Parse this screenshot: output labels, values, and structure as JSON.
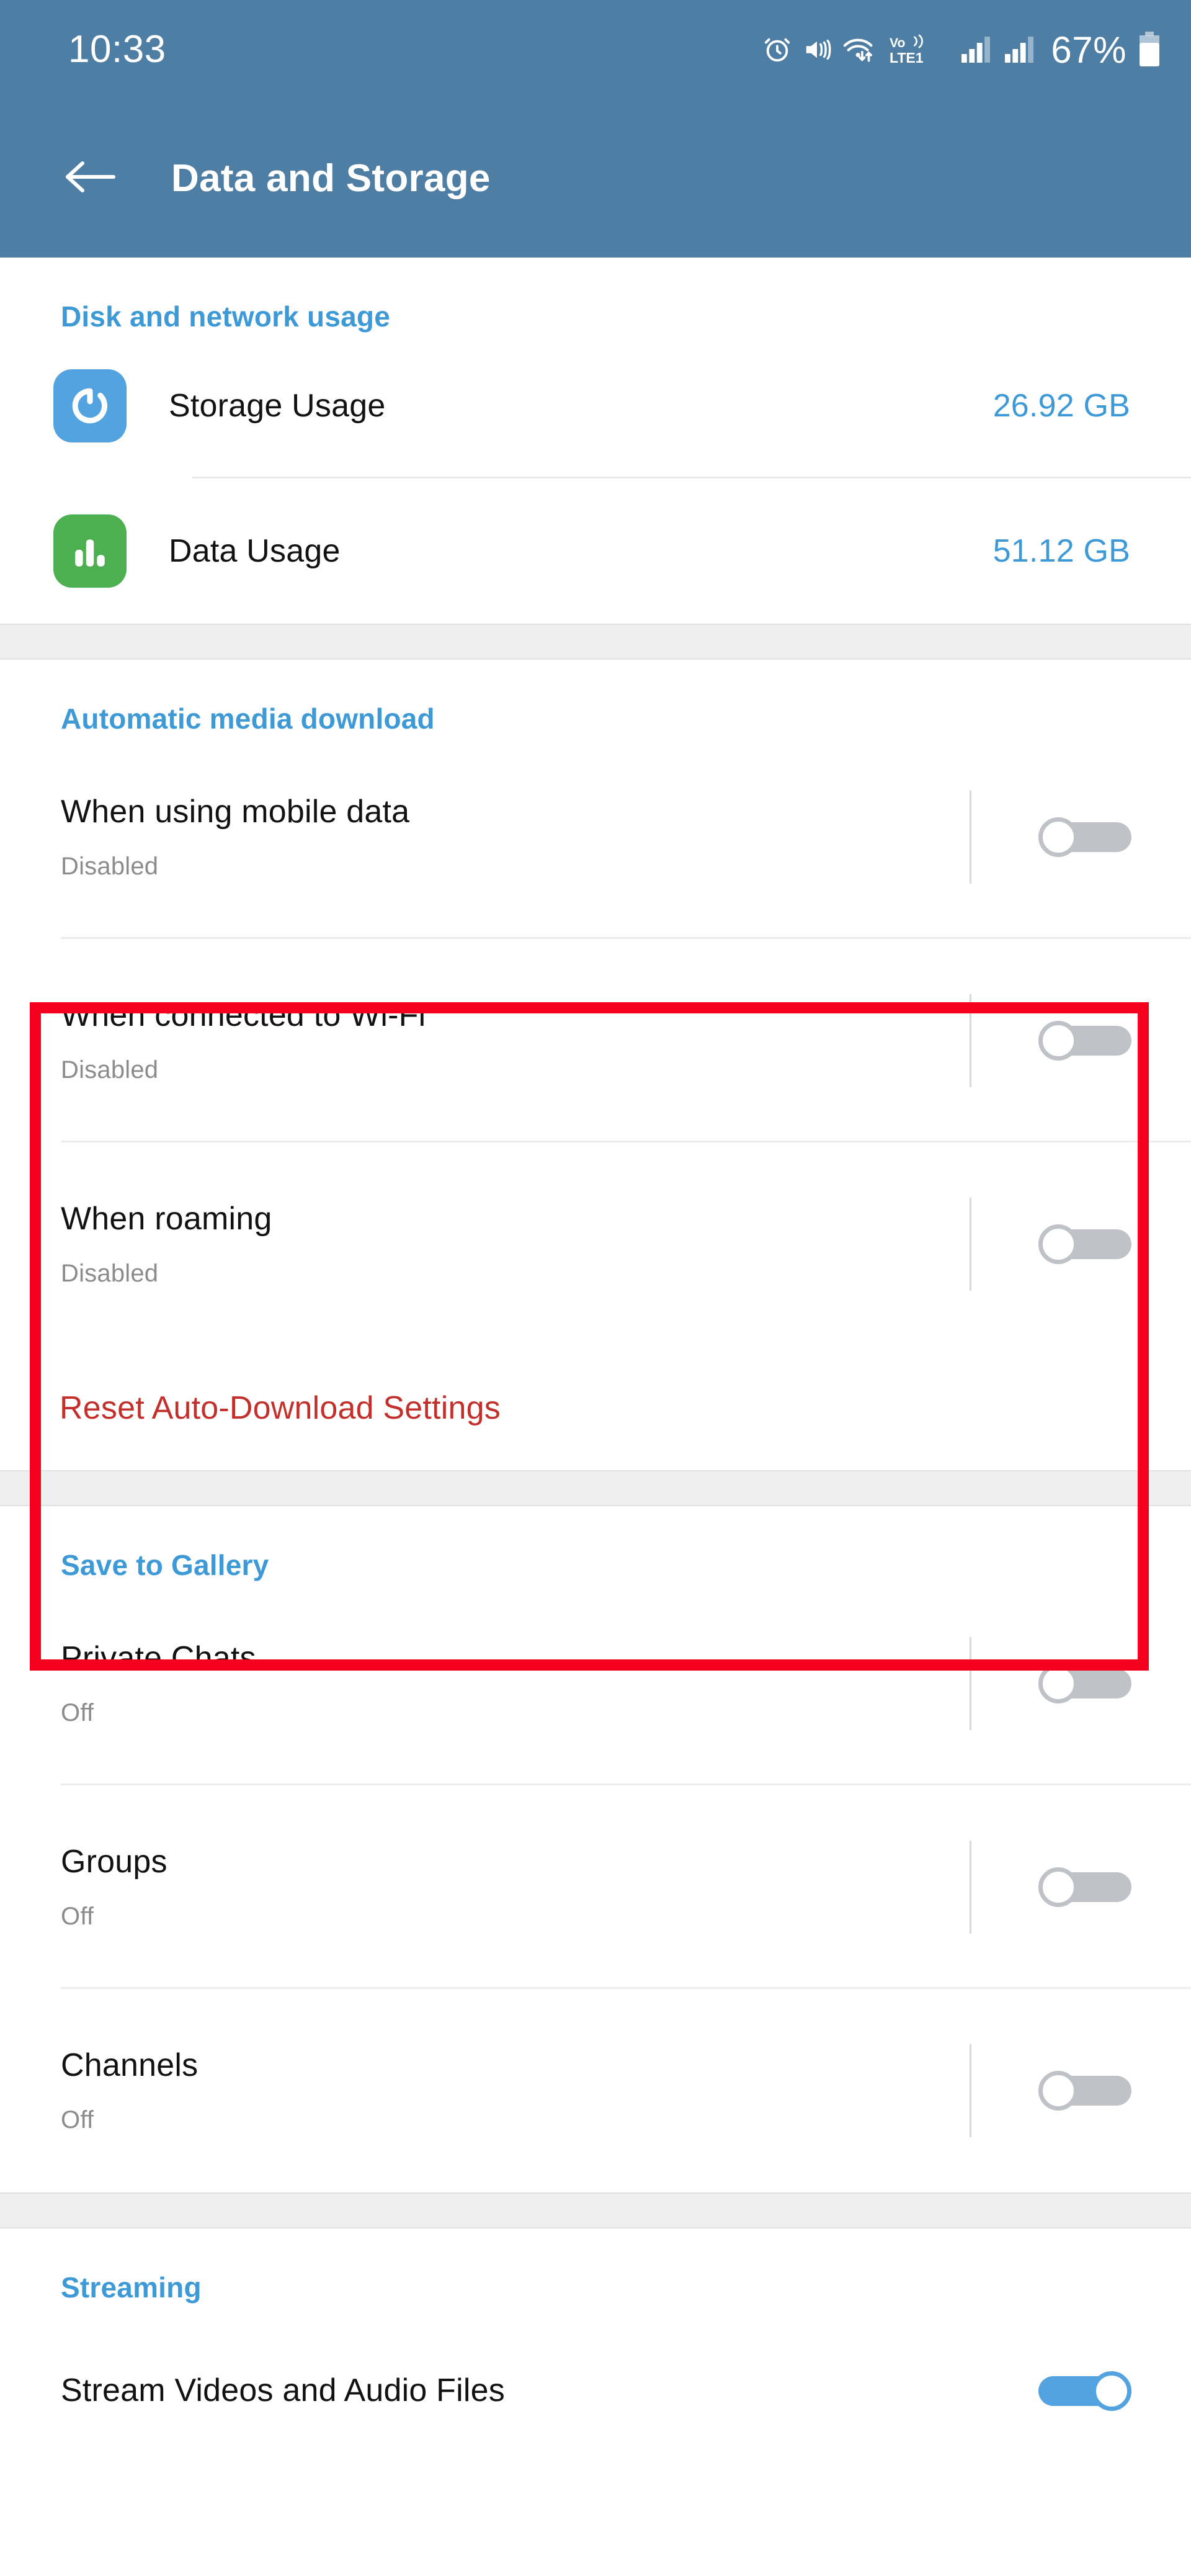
{
  "status_bar": {
    "time": "10:33",
    "battery_percent": "67%",
    "network_label": "LTE1",
    "volte_label": "Vo)",
    "icons": [
      "alarm-icon",
      "vibrate-mute-icon",
      "wifi-transfer-icon",
      "volte-icon",
      "signal-sim1-icon",
      "signal-sim2-icon",
      "battery-icon"
    ]
  },
  "app_bar": {
    "back_icon": "arrow-left-icon",
    "title": "Data and Storage"
  },
  "colors": {
    "header_blue": "#4E7EA3",
    "accent_blue": "#3D9AD6",
    "toggle_on_blue": "#52A3E0",
    "toggle_off_gray": "#BFC3C7",
    "destructive_red": "#C3302B",
    "annotation_red": "#F5001E",
    "storage_icon_bg": "#52A3E0",
    "data_icon_bg": "#4CB050",
    "band_gray": "#efefef"
  },
  "sections": {
    "disk_network": {
      "header": "Disk and network usage",
      "rows": [
        {
          "icon": "storage-refresh-icon",
          "label": "Storage Usage",
          "value": "26.92 GB"
        },
        {
          "icon": "data-bars-icon",
          "label": "Data Usage",
          "value": "51.12 GB"
        }
      ]
    },
    "auto_download": {
      "header": "Automatic media download",
      "rows": [
        {
          "title": "When using mobile data",
          "subtitle": "Disabled",
          "toggle": "off"
        },
        {
          "title": "When connected to Wi-Fi",
          "subtitle": "Disabled",
          "toggle": "off"
        },
        {
          "title": "When roaming",
          "subtitle": "Disabled",
          "toggle": "off"
        }
      ],
      "reset_label": "Reset Auto-Download Settings"
    },
    "save_to_gallery": {
      "header": "Save to Gallery",
      "rows": [
        {
          "title": "Private Chats",
          "subtitle": "Off",
          "toggle": "off"
        },
        {
          "title": "Groups",
          "subtitle": "Off",
          "toggle": "off"
        },
        {
          "title": "Channels",
          "subtitle": "Off",
          "toggle": "off"
        }
      ]
    },
    "streaming": {
      "header": "Streaming",
      "rows": [
        {
          "title": "Stream Videos and Audio Files",
          "subtitle": "",
          "toggle": "on"
        }
      ]
    }
  }
}
